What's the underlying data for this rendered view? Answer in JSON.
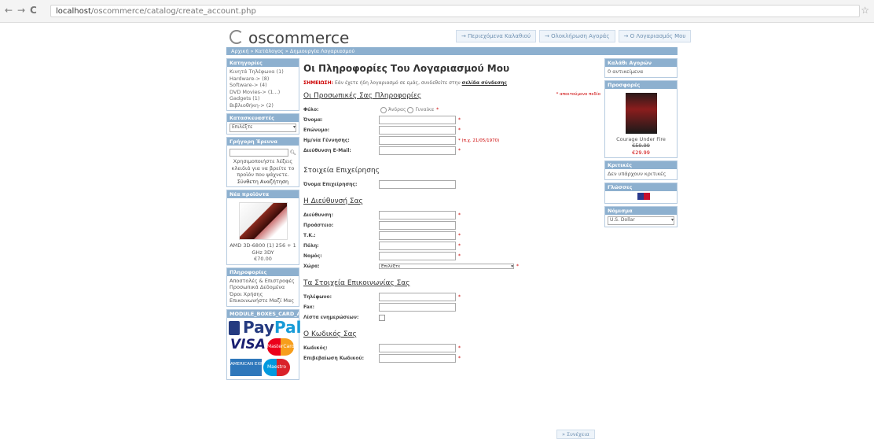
{
  "browser": {
    "back": "←",
    "forward": "→",
    "reload": "C",
    "url_host": "localhost",
    "url_path": "/oscommerce/catalog/create_account.php",
    "star": "☆"
  },
  "header": {
    "logo": "oscommerce",
    "buttons": [
      "→ Περιεχόμενα Καλαθιού",
      "→ Ολοκλήρωση Αγοράς",
      "→ Ο Λογαριασμός Μου"
    ]
  },
  "breadcrumb": "Αρχική » Κατάλογος » Δημιουργία Λογαριασμού",
  "left": {
    "categories_title": "Κατηγορίες",
    "categories": [
      "Κινητά Τηλέφωνα (1)",
      "Hardware-> (8)",
      "Software-> (4)",
      "DVD Movies-> (1...)",
      "Gadgets (1)",
      "Βιβλιοθήκη-> (2)"
    ],
    "manufacturers_title": "Κατασκευαστές",
    "manufacturers_select": "Επιλέξτε",
    "quick_search_title": "Γρήγορη Έρευνα",
    "quick_search_text": "Χρησιμοποιήστε λέξεις κλειδιά για να βρείτε το προϊόν που ψάχνετε.",
    "advanced_search": "Σύνθετη Αναζήτηση",
    "whats_new_title": "Νέα προϊόντα",
    "whats_new_product": "AMD 3D-6800 (1) 256 + 1 GHz 3DY",
    "whats_new_price": "€70.00",
    "information_title": "Πληροφορίες",
    "information_links": [
      "Αποστολές & Επιστροφές",
      "Προσωπικά Δεδομένα",
      "Όροι Χρήσης",
      "Επικοινωνήστε Μαζί Μας"
    ],
    "payment_title": "MODULE_BOXES_CARD_AC",
    "paypal": "Pay",
    "paypal_pal": "Pal",
    "visa": "VISA",
    "mastercard": "MasterCard",
    "amex": "AMERICAN EXPRESS",
    "maestro": "Maestro"
  },
  "right": {
    "cart_title": "Καλάθι Αγορών",
    "cart_text": "0 αντικείμενα",
    "bestsellers_title": "Προσφορές",
    "special_name": "Courage Under Fire",
    "special_old_price": "€59.99",
    "special_new_price": "€29.99",
    "reviews_title": "Κριτικές",
    "reviews_text": "Δεν υπάρχουν κριτικές",
    "languages_title": "Γλώσσες",
    "currencies_title": "Νόμισμα",
    "currency_select": "U.S. Dollar"
  },
  "main": {
    "title": "Οι Πληροφορίες Του Λογαριασμού Μου",
    "notice_red": "ΣΗΜΕΙΩΣΗ:",
    "notice_text": "Εάν έχετε ήδη λογαριασμό σε εμάς, συνδεθείτε στην",
    "notice_link": "σελίδα σύνδεσης",
    "personal_title": "Οι Προσωπικές Σας Πληροφορίες",
    "required_note": "* απαιτούμενο πεδίο",
    "gender_label": "Φύλο:",
    "gender_male": "Άνδρας",
    "gender_female": "Γυναίκα",
    "first_name_label": "Όνομα:",
    "last_name_label": "Επώνυμο:",
    "dob_label": "Ημ/νία Γέννησης:",
    "dob_hint": "* (π.χ. 21/05/1970)",
    "email_label": "Διεύθυνση E-Mail:",
    "company_title": "Στοιχεία Επιχείρησης",
    "company_label": "Όνομα Επιχείρησης:",
    "address_title": "Η Διεύθυνσή Σας",
    "street_label": "Διεύθυνση:",
    "suburb_label": "Προάστειο:",
    "postcode_label": "Τ.Κ.:",
    "city_label": "Πόλη:",
    "state_label": "Νομός:",
    "country_label": "Χώρα:",
    "country_select": "Επιλέξτε",
    "contact_title": "Τα Στοιχεία Επικοινωνίας Σας",
    "phone_label": "Τηλέφωνο:",
    "fax_label": "Fax:",
    "newsletter_label": "Λίστα ενημερώσεων:",
    "password_title": "Ο Κωδικός Σας",
    "password_label": "Κωδικός:",
    "confirm_label": "Επιβεβαίωση Κωδικού:",
    "asterisk": "*",
    "continue": "» Συνέχεια"
  }
}
